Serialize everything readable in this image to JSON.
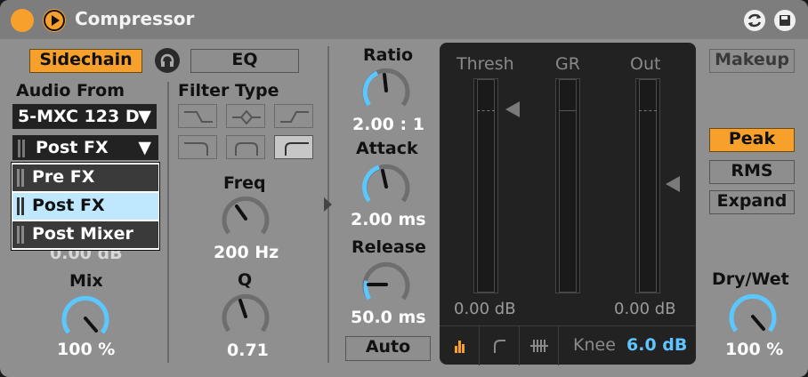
{
  "device": {
    "title": "Compressor",
    "icons": [
      "power-icon",
      "play-icon",
      "hot-swap-icon",
      "save-preset-icon"
    ],
    "accent": "#f7a12c"
  },
  "sidechain": {
    "sidechain_label": "Sidechain",
    "eq_label": "EQ",
    "audio_from_label": "Audio From",
    "audio_from_value": "5-MXC 123 D",
    "tap_value": "Post FX",
    "dropdown_options": [
      "Pre FX",
      "Post FX",
      "Post Mixer"
    ],
    "selected_option": "Post FX",
    "gain_value_partial": "0.00 dB",
    "mix_label": "Mix",
    "mix_value": "100 %"
  },
  "filter": {
    "filter_type_label": "Filter Type",
    "types": [
      "low-pass-icon",
      "band-pass-icon",
      "high-pass-icon",
      "shelf-low-icon",
      "peak-icon",
      "shelf-high-icon"
    ],
    "active_type": "shelf-high-icon",
    "freq_label": "Freq",
    "freq_value": "200 Hz",
    "q_label": "Q",
    "q_value": "0.71"
  },
  "dynamics": {
    "ratio_label": "Ratio",
    "ratio_value": "2.00 : 1",
    "attack_label": "Attack",
    "attack_value": "2.00 ms",
    "release_label": "Release",
    "release_value": "50.0 ms",
    "auto_label": "Auto"
  },
  "meters": {
    "thresh_label": "Thresh",
    "gr_label": "GR",
    "out_label": "Out",
    "thresh_value": "0.00 dB",
    "out_value": "0.00 dB",
    "knee_label": "Knee",
    "knee_value": "6.0 dB",
    "knee_color": "#5fc4ff"
  },
  "right": {
    "makeup_label": "Makeup",
    "peak_label": "Peak",
    "rms_label": "RMS",
    "expand_label": "Expand",
    "drywet_label": "Dry/Wet",
    "drywet_value": "100 %"
  }
}
